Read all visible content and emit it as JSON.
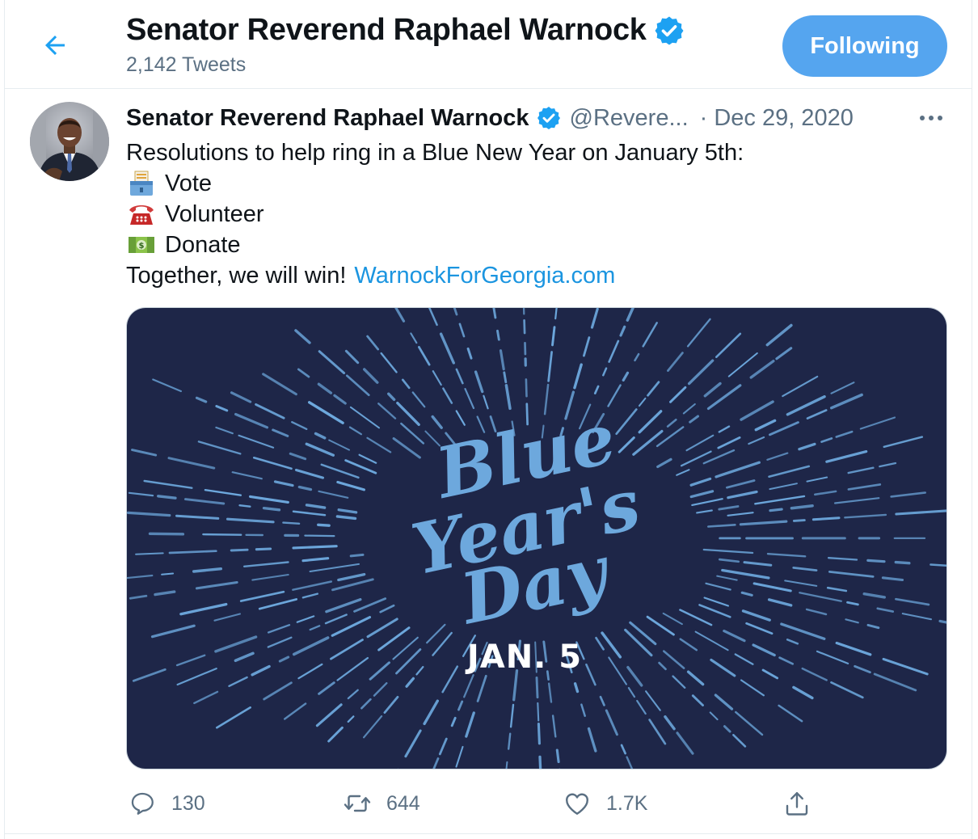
{
  "header": {
    "title": "Senator Reverend Raphael Warnock",
    "tweet_count": "2,142 Tweets",
    "follow_label": "Following"
  },
  "tweet": {
    "name": "Senator Reverend Raphael Warnock",
    "handle": "@Revere...",
    "separator": "·",
    "date": "Dec 29, 2020",
    "text_intro": "Resolutions to help ring in a Blue New Year on January 5th:",
    "items": [
      {
        "emoji": "ballot-box-icon",
        "label": "Vote"
      },
      {
        "emoji": "telephone-icon",
        "label": "Volunteer"
      },
      {
        "emoji": "dollar-banknote-icon",
        "label": "Donate"
      }
    ],
    "closing_text": "Together, we will win!",
    "link_text": "WarnockForGeorgia.com",
    "media": {
      "line1": "Blue",
      "line2": "Year's",
      "line3": "Day",
      "date": "JAN. 5",
      "background": "#1e2648",
      "accent": "#6da8dd"
    },
    "actions": {
      "replies": "130",
      "retweets": "644",
      "likes": "1.7K"
    }
  },
  "colors": {
    "brand": "#1da1f2",
    "follow_button": "#55a5ef",
    "link": "#1b95e0",
    "muted": "#5b7083"
  }
}
